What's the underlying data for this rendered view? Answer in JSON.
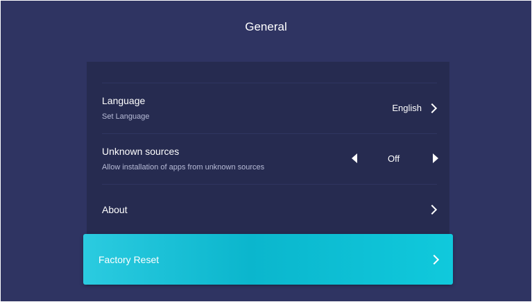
{
  "page": {
    "title": "General"
  },
  "settings": {
    "language": {
      "label": "Language",
      "subtitle": "Set Language",
      "value": "English"
    },
    "unknown_sources": {
      "label": "Unknown sources",
      "subtitle": "Allow installation of apps from unknown sources",
      "value": "Off"
    },
    "about": {
      "label": "About"
    },
    "factory_reset": {
      "label": "Factory Reset"
    }
  },
  "colors": {
    "background": "#2f3462",
    "panel": "#262b50",
    "accent": "#0bb6cd"
  }
}
